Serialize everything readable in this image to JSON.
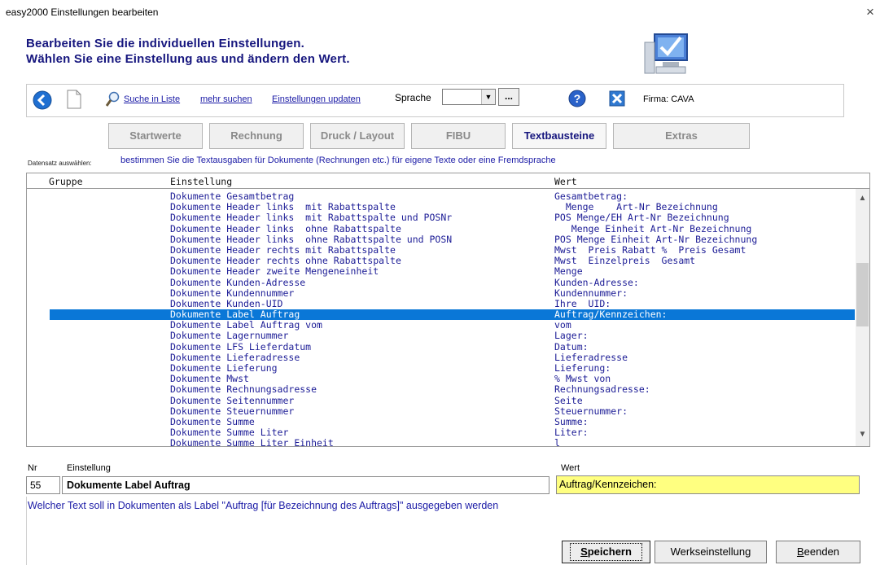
{
  "window": {
    "title": "easy2000 Einstellungen bearbeiten",
    "close_glyph": "×"
  },
  "header": {
    "line1": "Bearbeiten Sie die individuellen Einstellungen.",
    "line2": "Wählen Sie eine Einstellung aus und ändern den Wert."
  },
  "toolbar": {
    "search_list": "Suche in Liste",
    "more_search": "mehr suchen",
    "update_settings": "Einstellungen updaten",
    "language_label": "Sprache",
    "language_value": "",
    "ellipsis": "...",
    "firma": "Firma: CAVA"
  },
  "tabs": [
    {
      "label": "Startwerte",
      "active": false
    },
    {
      "label": "Rechnung",
      "active": false
    },
    {
      "label": "Druck / Layout",
      "active": false
    },
    {
      "label": "FIBU",
      "active": false
    },
    {
      "label": "Textbausteine",
      "active": true
    },
    {
      "label": "Extras",
      "active": false
    }
  ],
  "record": {
    "label": "Datensatz auswählen:",
    "description": "bestimmen Sie die Textausgaben für Dokumente (Rechnungen etc.) für eigene Texte oder eine Fremdsprache"
  },
  "grid": {
    "columns": [
      "Gruppe",
      "Einstellung",
      "Wert"
    ],
    "selected_index": 11,
    "rows": [
      {
        "einstellung": "Dokumente Gesamtbetrag",
        "wert": "Gesamtbetrag:"
      },
      {
        "einstellung": "Dokumente Header links  mit Rabattspalte",
        "wert": "  Menge    Art-Nr Bezeichnung"
      },
      {
        "einstellung": "Dokumente Header links  mit Rabattspalte und POSNr",
        "wert": "POS Menge/EH Art-Nr Bezeichnung"
      },
      {
        "einstellung": "Dokumente Header links  ohne Rabattspalte",
        "wert": "   Menge Einheit Art-Nr Bezeichnung"
      },
      {
        "einstellung": "Dokumente Header links  ohne Rabattspalte und POSN",
        "wert": "POS Menge Einheit Art-Nr Bezeichnung"
      },
      {
        "einstellung": "Dokumente Header rechts mit Rabattspalte",
        "wert": "Mwst  Preis Rabatt %  Preis Gesamt"
      },
      {
        "einstellung": "Dokumente Header rechts ohne Rabattspalte",
        "wert": "Mwst  Einzelpreis  Gesamt"
      },
      {
        "einstellung": "Dokumente Header zweite Mengeneinheit",
        "wert": "Menge"
      },
      {
        "einstellung": "Dokumente Kunden-Adresse",
        "wert": "Kunden-Adresse:"
      },
      {
        "einstellung": "Dokumente Kundennummer",
        "wert": "Kundennummer:"
      },
      {
        "einstellung": "Dokumente Kunden-UID",
        "wert": "Ihre  UID:"
      },
      {
        "einstellung": "Dokumente Label Auftrag",
        "wert": "Auftrag/Kennzeichen:"
      },
      {
        "einstellung": "Dokumente Label Auftrag vom",
        "wert": "vom"
      },
      {
        "einstellung": "Dokumente Lagernummer",
        "wert": "Lager:"
      },
      {
        "einstellung": "Dokumente LFS Lieferdatum",
        "wert": "Datum:"
      },
      {
        "einstellung": "Dokumente Lieferadresse",
        "wert": "Lieferadresse"
      },
      {
        "einstellung": "Dokumente Lieferung",
        "wert": "Lieferung:"
      },
      {
        "einstellung": "Dokumente Mwst",
        "wert": "% Mwst von"
      },
      {
        "einstellung": "Dokumente Rechnungsadresse",
        "wert": "Rechnungsadresse:"
      },
      {
        "einstellung": "Dokumente Seitennummer",
        "wert": "Seite"
      },
      {
        "einstellung": "Dokumente Steuernummer",
        "wert": "Steuernummer:"
      },
      {
        "einstellung": "Dokumente Summe",
        "wert": "Summe:"
      },
      {
        "einstellung": "Dokumente Summe Liter",
        "wert": "Liter:"
      },
      {
        "einstellung": "Dokumente Summe Liter Einheit",
        "wert": "l"
      }
    ]
  },
  "detail": {
    "nr_label": "Nr",
    "einstellung_label": "Einstellung",
    "wert_label": "Wert",
    "nr": "55",
    "einstellung": "Dokumente Label Auftrag",
    "wert": "Auftrag/Kennzeichen:",
    "help": "Welcher Text soll in Dokumenten als Label \"Auftrag [für Bezeichnung des Auftrags]\" ausgegeben werden"
  },
  "buttons": {
    "save_first": "S",
    "save_rest": "peichern",
    "factory": "Werkseinstellung",
    "quit_first": "B",
    "quit_rest": "eenden"
  },
  "colors": {
    "selection": "#0a77d7",
    "header_text": "#16167e",
    "wert_bg": "#ffff80"
  }
}
